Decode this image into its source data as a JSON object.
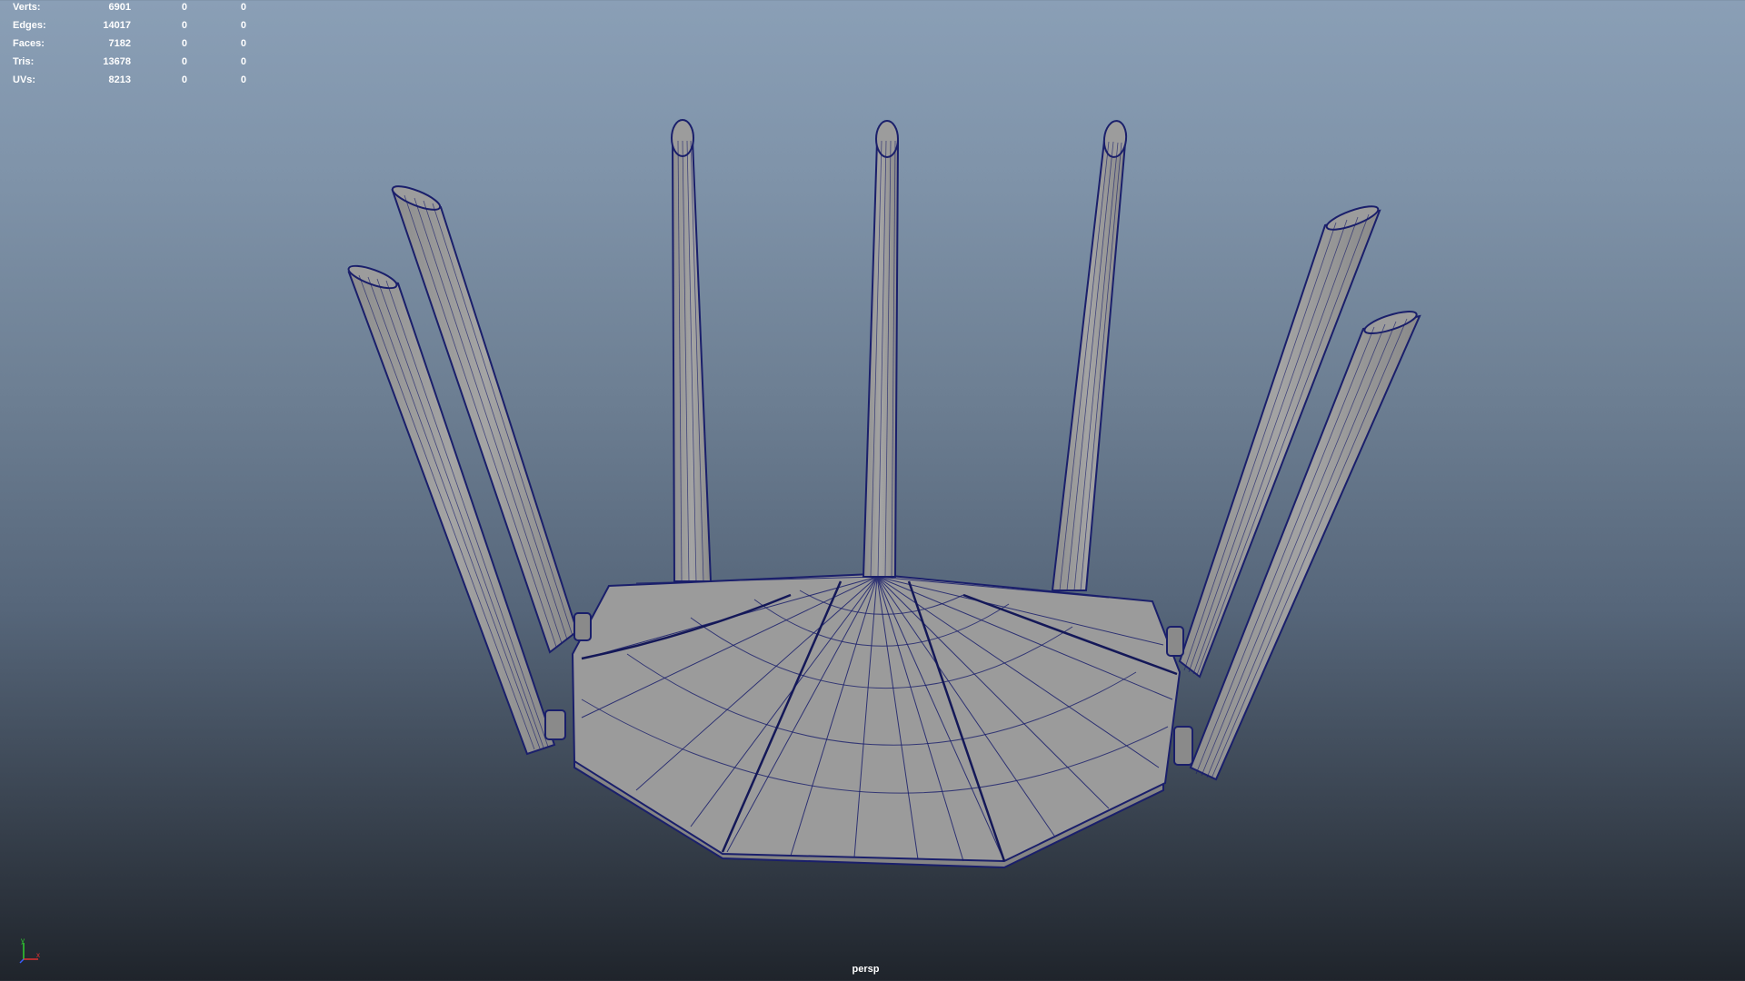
{
  "hud": {
    "rows": [
      {
        "label": "Verts:",
        "values": [
          "6901",
          "0",
          "0"
        ]
      },
      {
        "label": "Edges:",
        "values": [
          "14017",
          "0",
          "0"
        ]
      },
      {
        "label": "Faces:",
        "values": [
          "7182",
          "0",
          "0"
        ]
      },
      {
        "label": "Tris:",
        "values": [
          "13678",
          "0",
          "0"
        ]
      },
      {
        "label": "UVs:",
        "values": [
          "8213",
          "0",
          "0"
        ]
      }
    ]
  },
  "camera": "persp",
  "axis": {
    "y": "y",
    "x": "x"
  },
  "colors": {
    "wireframe": "#1a1f6b",
    "shaded": "#9a9a9a",
    "axis_y": "#2fd02f",
    "axis_x": "#e03030",
    "axis_z": "#3a5cff"
  }
}
